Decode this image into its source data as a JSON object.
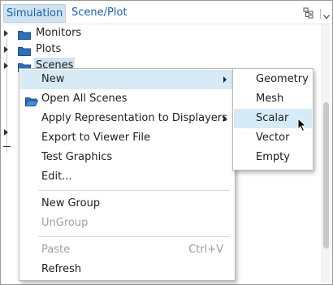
{
  "tabs": [
    {
      "label": "Simulation",
      "active": true
    },
    {
      "label": "Scene/Plot",
      "active": false
    }
  ],
  "toolbar_icons": [
    "tree-layout-icon",
    "dropdown-arrow-icon"
  ],
  "tree": [
    {
      "label": "Monitors",
      "icon": "folder-icon",
      "state": "collapsed"
    },
    {
      "label": "Plots",
      "icon": "folder-icon",
      "state": "collapsed"
    },
    {
      "label": "Scenes",
      "icon": "folder-icon",
      "state": "selected"
    }
  ],
  "context_menu": {
    "items": [
      {
        "label": "New",
        "submenu": true,
        "highlighted": true
      },
      {
        "label": "Open All Scenes",
        "icon": "open-folder-icon"
      },
      {
        "label": "Apply Representation to Displayers",
        "submenu": true
      },
      {
        "label": "Export to Viewer File"
      },
      {
        "label": "Test Graphics"
      },
      {
        "label": "Edit..."
      },
      {
        "label": "New Group"
      },
      {
        "label": "UnGroup",
        "disabled": true
      },
      {
        "label": "Paste",
        "shortcut": "Ctrl+V",
        "disabled": true
      },
      {
        "label": "Refresh"
      }
    ]
  },
  "submenu": {
    "items": [
      {
        "label": "Geometry"
      },
      {
        "label": "Mesh"
      },
      {
        "label": "Scalar",
        "highlighted": true
      },
      {
        "label": "Vector"
      },
      {
        "label": "Empty"
      }
    ]
  },
  "colors": {
    "accent": "#1a5fa3",
    "highlight": "#d7ebf7",
    "folder": "#2f6fb5"
  }
}
